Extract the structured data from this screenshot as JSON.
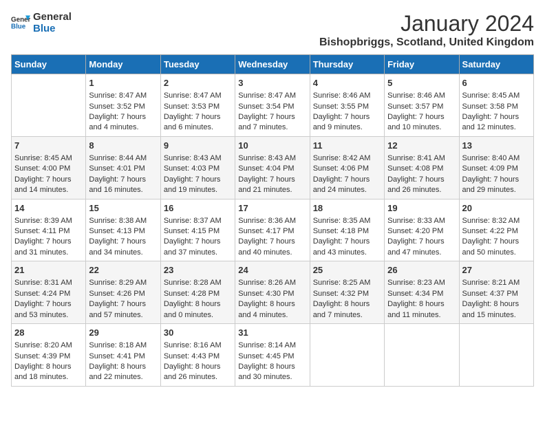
{
  "logo": {
    "line1": "General",
    "line2": "Blue"
  },
  "title": "January 2024",
  "location": "Bishopbriggs, Scotland, United Kingdom",
  "days_of_week": [
    "Sunday",
    "Monday",
    "Tuesday",
    "Wednesday",
    "Thursday",
    "Friday",
    "Saturday"
  ],
  "weeks": [
    [
      {
        "day": "",
        "sunrise": "",
        "sunset": "",
        "daylight": ""
      },
      {
        "day": "1",
        "sunrise": "Sunrise: 8:47 AM",
        "sunset": "Sunset: 3:52 PM",
        "daylight": "Daylight: 7 hours and 4 minutes."
      },
      {
        "day": "2",
        "sunrise": "Sunrise: 8:47 AM",
        "sunset": "Sunset: 3:53 PM",
        "daylight": "Daylight: 7 hours and 6 minutes."
      },
      {
        "day": "3",
        "sunrise": "Sunrise: 8:47 AM",
        "sunset": "Sunset: 3:54 PM",
        "daylight": "Daylight: 7 hours and 7 minutes."
      },
      {
        "day": "4",
        "sunrise": "Sunrise: 8:46 AM",
        "sunset": "Sunset: 3:55 PM",
        "daylight": "Daylight: 7 hours and 9 minutes."
      },
      {
        "day": "5",
        "sunrise": "Sunrise: 8:46 AM",
        "sunset": "Sunset: 3:57 PM",
        "daylight": "Daylight: 7 hours and 10 minutes."
      },
      {
        "day": "6",
        "sunrise": "Sunrise: 8:45 AM",
        "sunset": "Sunset: 3:58 PM",
        "daylight": "Daylight: 7 hours and 12 minutes."
      }
    ],
    [
      {
        "day": "7",
        "sunrise": "Sunrise: 8:45 AM",
        "sunset": "Sunset: 4:00 PM",
        "daylight": "Daylight: 7 hours and 14 minutes."
      },
      {
        "day": "8",
        "sunrise": "Sunrise: 8:44 AM",
        "sunset": "Sunset: 4:01 PM",
        "daylight": "Daylight: 7 hours and 16 minutes."
      },
      {
        "day": "9",
        "sunrise": "Sunrise: 8:43 AM",
        "sunset": "Sunset: 4:03 PM",
        "daylight": "Daylight: 7 hours and 19 minutes."
      },
      {
        "day": "10",
        "sunrise": "Sunrise: 8:43 AM",
        "sunset": "Sunset: 4:04 PM",
        "daylight": "Daylight: 7 hours and 21 minutes."
      },
      {
        "day": "11",
        "sunrise": "Sunrise: 8:42 AM",
        "sunset": "Sunset: 4:06 PM",
        "daylight": "Daylight: 7 hours and 24 minutes."
      },
      {
        "day": "12",
        "sunrise": "Sunrise: 8:41 AM",
        "sunset": "Sunset: 4:08 PM",
        "daylight": "Daylight: 7 hours and 26 minutes."
      },
      {
        "day": "13",
        "sunrise": "Sunrise: 8:40 AM",
        "sunset": "Sunset: 4:09 PM",
        "daylight": "Daylight: 7 hours and 29 minutes."
      }
    ],
    [
      {
        "day": "14",
        "sunrise": "Sunrise: 8:39 AM",
        "sunset": "Sunset: 4:11 PM",
        "daylight": "Daylight: 7 hours and 31 minutes."
      },
      {
        "day": "15",
        "sunrise": "Sunrise: 8:38 AM",
        "sunset": "Sunset: 4:13 PM",
        "daylight": "Daylight: 7 hours and 34 minutes."
      },
      {
        "day": "16",
        "sunrise": "Sunrise: 8:37 AM",
        "sunset": "Sunset: 4:15 PM",
        "daylight": "Daylight: 7 hours and 37 minutes."
      },
      {
        "day": "17",
        "sunrise": "Sunrise: 8:36 AM",
        "sunset": "Sunset: 4:17 PM",
        "daylight": "Daylight: 7 hours and 40 minutes."
      },
      {
        "day": "18",
        "sunrise": "Sunrise: 8:35 AM",
        "sunset": "Sunset: 4:18 PM",
        "daylight": "Daylight: 7 hours and 43 minutes."
      },
      {
        "day": "19",
        "sunrise": "Sunrise: 8:33 AM",
        "sunset": "Sunset: 4:20 PM",
        "daylight": "Daylight: 7 hours and 47 minutes."
      },
      {
        "day": "20",
        "sunrise": "Sunrise: 8:32 AM",
        "sunset": "Sunset: 4:22 PM",
        "daylight": "Daylight: 7 hours and 50 minutes."
      }
    ],
    [
      {
        "day": "21",
        "sunrise": "Sunrise: 8:31 AM",
        "sunset": "Sunset: 4:24 PM",
        "daylight": "Daylight: 7 hours and 53 minutes."
      },
      {
        "day": "22",
        "sunrise": "Sunrise: 8:29 AM",
        "sunset": "Sunset: 4:26 PM",
        "daylight": "Daylight: 7 hours and 57 minutes."
      },
      {
        "day": "23",
        "sunrise": "Sunrise: 8:28 AM",
        "sunset": "Sunset: 4:28 PM",
        "daylight": "Daylight: 8 hours and 0 minutes."
      },
      {
        "day": "24",
        "sunrise": "Sunrise: 8:26 AM",
        "sunset": "Sunset: 4:30 PM",
        "daylight": "Daylight: 8 hours and 4 minutes."
      },
      {
        "day": "25",
        "sunrise": "Sunrise: 8:25 AM",
        "sunset": "Sunset: 4:32 PM",
        "daylight": "Daylight: 8 hours and 7 minutes."
      },
      {
        "day": "26",
        "sunrise": "Sunrise: 8:23 AM",
        "sunset": "Sunset: 4:34 PM",
        "daylight": "Daylight: 8 hours and 11 minutes."
      },
      {
        "day": "27",
        "sunrise": "Sunrise: 8:21 AM",
        "sunset": "Sunset: 4:37 PM",
        "daylight": "Daylight: 8 hours and 15 minutes."
      }
    ],
    [
      {
        "day": "28",
        "sunrise": "Sunrise: 8:20 AM",
        "sunset": "Sunset: 4:39 PM",
        "daylight": "Daylight: 8 hours and 18 minutes."
      },
      {
        "day": "29",
        "sunrise": "Sunrise: 8:18 AM",
        "sunset": "Sunset: 4:41 PM",
        "daylight": "Daylight: 8 hours and 22 minutes."
      },
      {
        "day": "30",
        "sunrise": "Sunrise: 8:16 AM",
        "sunset": "Sunset: 4:43 PM",
        "daylight": "Daylight: 8 hours and 26 minutes."
      },
      {
        "day": "31",
        "sunrise": "Sunrise: 8:14 AM",
        "sunset": "Sunset: 4:45 PM",
        "daylight": "Daylight: 8 hours and 30 minutes."
      },
      {
        "day": "",
        "sunrise": "",
        "sunset": "",
        "daylight": ""
      },
      {
        "day": "",
        "sunrise": "",
        "sunset": "",
        "daylight": ""
      },
      {
        "day": "",
        "sunrise": "",
        "sunset": "",
        "daylight": ""
      }
    ]
  ]
}
